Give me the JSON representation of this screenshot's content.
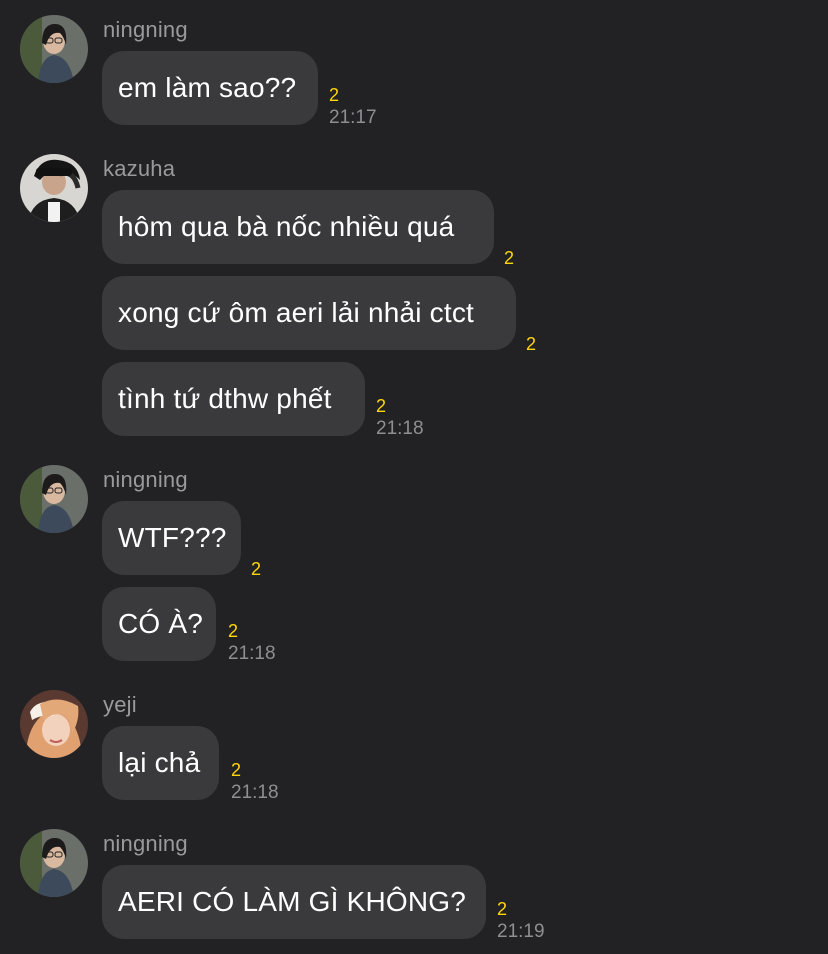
{
  "colors": {
    "background": "#222224",
    "bubble": "#3a3a3c",
    "sender_name": "#9a9a9e",
    "unread_count": "#ffd60a",
    "timestamp": "#8e8e93"
  },
  "messages": [
    {
      "sender": "ningning",
      "text": "em làm sao??",
      "unread": "2",
      "time": "21:17"
    },
    {
      "sender": "kazuha",
      "text": "hôm qua bà nốc nhiều quá",
      "unread": "2",
      "time": ""
    },
    {
      "sender": "kazuha",
      "text": "xong cứ ôm aeri lải nhải ctct",
      "unread": "2",
      "time": ""
    },
    {
      "sender": "kazuha",
      "text": "tình tứ dthw phết",
      "unread": "2",
      "time": "21:18"
    },
    {
      "sender": "ningning",
      "text": "WTF???",
      "unread": "2",
      "time": ""
    },
    {
      "sender": "ningning",
      "text": "CÓ À?",
      "unread": "2",
      "time": "21:18"
    },
    {
      "sender": "yeji",
      "text": "lại chả",
      "unread": "2",
      "time": "21:18"
    },
    {
      "sender": "ningning",
      "text": "AERI CÓ LÀM GÌ KHÔNG?",
      "unread": "2",
      "time": "21:19"
    }
  ],
  "avatars": {
    "ningning": "ningning-avatar",
    "kazuha": "kazuha-avatar",
    "yeji": "yeji-avatar"
  }
}
